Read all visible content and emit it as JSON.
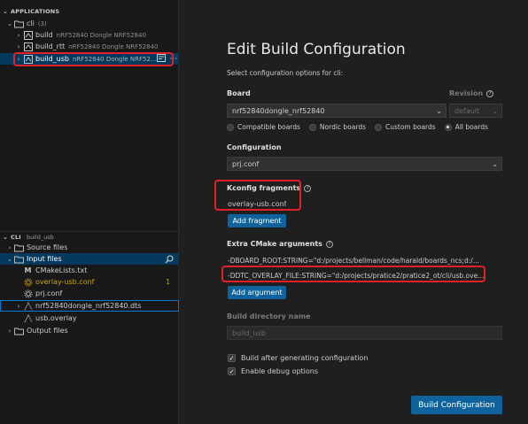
{
  "applications": {
    "header": "APPLICATIONS",
    "app_name": "cli",
    "app_count": "(3)",
    "builds": [
      {
        "name": "build",
        "board": "nRF52840 Dongle NRF52840"
      },
      {
        "name": "build_rtt",
        "board": "nRF52840 Dongle NRF52840"
      },
      {
        "name": "build_usb",
        "board": "nRF52840 Dongle NRF52..."
      }
    ],
    "more_glyph": "···"
  },
  "cli_section": {
    "header": "CLI",
    "sub": "build_usb",
    "items": {
      "source_files": "Source files",
      "input_files": "Input files",
      "cmakelists": "CMakeLists.txt",
      "overlay_usb": "overlay-usb.conf",
      "overlay_badge": "1",
      "prj_conf": "prj.conf",
      "dts": "nrf52840dongle_nrf52840.dts",
      "usb_overlay": "usb.overlay",
      "output_files": "Output files"
    }
  },
  "form": {
    "title": "Edit Build Configuration",
    "subtitle": "Select configuration options for cli:",
    "board_label": "Board",
    "board_value": "nrf52840dongle_nrf52840",
    "revision_label": "Revision",
    "revision_value": "default",
    "board_filters": [
      "Compatible boards",
      "Nordic boards",
      "Custom boards",
      "All boards"
    ],
    "configuration_label": "Configuration",
    "configuration_value": "prj.conf",
    "kconfig_label": "Kconfig fragments",
    "kconfig_value": "overlay-usb.conf",
    "add_fragment": "Add fragment",
    "cmake_label": "Extra CMake arguments",
    "cmake_args": [
      "-DBOARD_ROOT:STRING=\"d:/projects/bellman/code/harald/boards_ncs;d:/...",
      "-DDTC_OVERLAY_FILE:STRING=\"d:/projects/pratice2/pratice2_ot/cli/usb.ove..."
    ],
    "add_argument": "Add argument",
    "build_dir_label": "Build directory name",
    "build_dir_value": "build_usb",
    "check_build_after": "Build after generating configuration",
    "check_debug": "Enable debug options",
    "build_button": "Build Configuration",
    "help_glyph": "?"
  },
  "colors": {
    "accent": "#0e639c",
    "highlight_red": "#e0202a",
    "warning": "#cca700"
  }
}
